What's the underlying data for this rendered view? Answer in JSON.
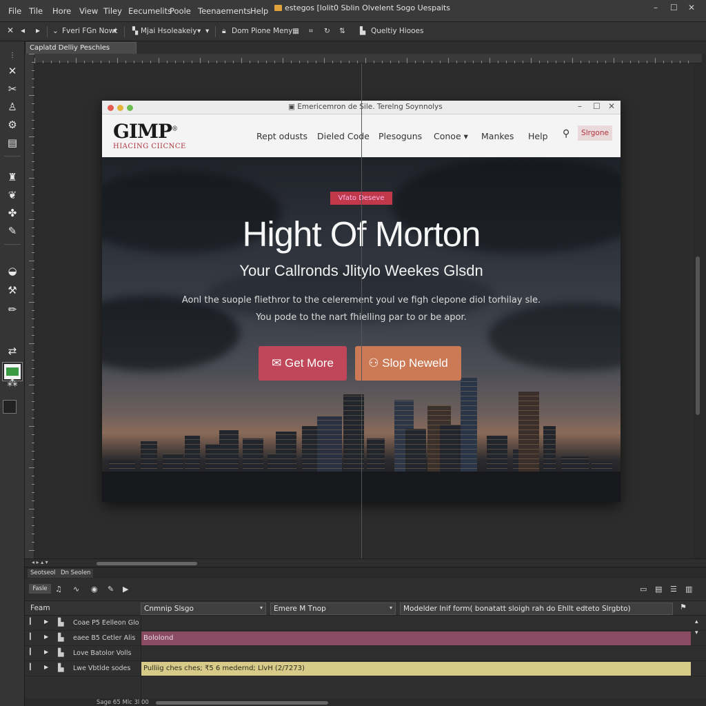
{
  "menubar": {
    "items": [
      "File",
      "Tile",
      "Hore",
      "View",
      "Tiley",
      "Eecumelits",
      "Poole",
      "Teenaements",
      "Help"
    ],
    "window_title": "estegos [lolit0 Sblin Olvelent Sogo Uespaits"
  },
  "options": {
    "item1": "Fveri FGn Nowt",
    "item2": "Mjai Hsoleakeiy",
    "item3": "Dom Pione Meny",
    "item4": "Queltiy Hiooes"
  },
  "tab": {
    "label": "Caplatd Delliy Peschles"
  },
  "browser": {
    "title": "Emericemron de Sile. Terelng Soynnolys",
    "logo": "GIMP",
    "logo_sub": "HIACING CIICNCE",
    "nav": [
      {
        "label": "Rept odusts"
      },
      {
        "label": "Dieled Code"
      },
      {
        "label": "Plesoguns"
      },
      {
        "label": "Conoe ▾"
      },
      {
        "label": "Mankes"
      },
      {
        "label": "Help"
      }
    ],
    "signup": "Slrgone"
  },
  "hero": {
    "badge": "Vfato Deseve",
    "headline": "Hight Of Morton",
    "subhead": "Your Callronds Jlitylo Weekes Glsdn",
    "body_line1": "Aonl the suople fliethror to the celerement youl ve figh clepone diol torhilay sle.",
    "body_line2": "You pode to the nart fhielling par to or be apor.",
    "cta1": "Get More",
    "cta2": "Slop Neweld"
  },
  "dock": {
    "tab1": "Seotseol",
    "tab2": "Dn Seolen",
    "mode": "Fasle",
    "header": {
      "label": "Feam",
      "select1": "Cnmnip Slsgo",
      "select2": "Emere M Tnop",
      "select3": "Modelder Inif form( bonatatt sloigh rah do Ehllt edteto Slrgbto)"
    },
    "layers": [
      {
        "name": "Coae P5 Eelleon Glo",
        "bar_text": "",
        "bar_color": ""
      },
      {
        "name": "eaee B5 Cetler Alis",
        "bar_text": "Bololond",
        "bar_color": "#8a4a62"
      },
      {
        "name": "Love Batolor Volls",
        "bar_text": "",
        "bar_color": ""
      },
      {
        "name": "Lwe Vbtlde sodes",
        "bar_text": "Pulliig ches ches; ₹5 6 medernd; LlvH (2/7273)",
        "bar_color": "#d8cb8a"
      }
    ],
    "status": "Sage 65 Mlc 3l 00"
  }
}
